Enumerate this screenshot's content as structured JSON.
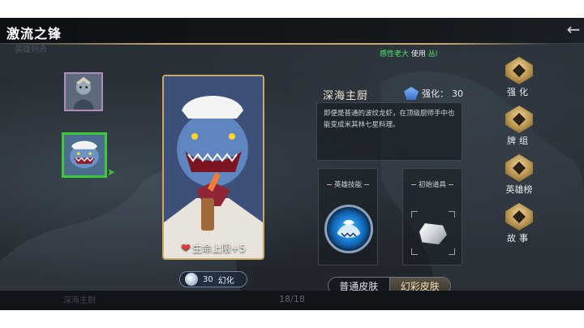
{
  "header": {
    "title": "激流之锋",
    "faded_title": "英雄列表"
  },
  "notice": {
    "nickname": "感性老大",
    "action": "使用",
    "tail": "丛I"
  },
  "hero_list": {
    "items": [
      {
        "name": "hero-thumb-1",
        "selected": false
      },
      {
        "name": "hero-thumb-2",
        "selected": true
      }
    ]
  },
  "hero_card": {
    "stat_text": "生命上限+5",
    "cost_value": "30",
    "cost_label": "幻化"
  },
  "hero_info": {
    "name": "深海主厨",
    "level_label": "强化：",
    "level_value": "30",
    "description": "即便是普通的波纹龙虾，在顶级厨师手中也能变成米其林七星料理。",
    "skill_title": "英雄技能",
    "item_title": "初始道具"
  },
  "skin_toggle": {
    "normal": "普通皮肤",
    "rainbow": "幻彩皮肤",
    "active": "rainbow"
  },
  "side_nav": [
    {
      "label": "强化",
      "icon": "enhance-icon"
    },
    {
      "label": "牌组",
      "icon": "deck-icon"
    },
    {
      "label": "英雄榜",
      "icon": "leaderboard-icon"
    },
    {
      "label": "故事",
      "icon": "story-icon"
    }
  ],
  "footer": {
    "page_indicator": "18/18",
    "faded_text": "深海主厨"
  }
}
